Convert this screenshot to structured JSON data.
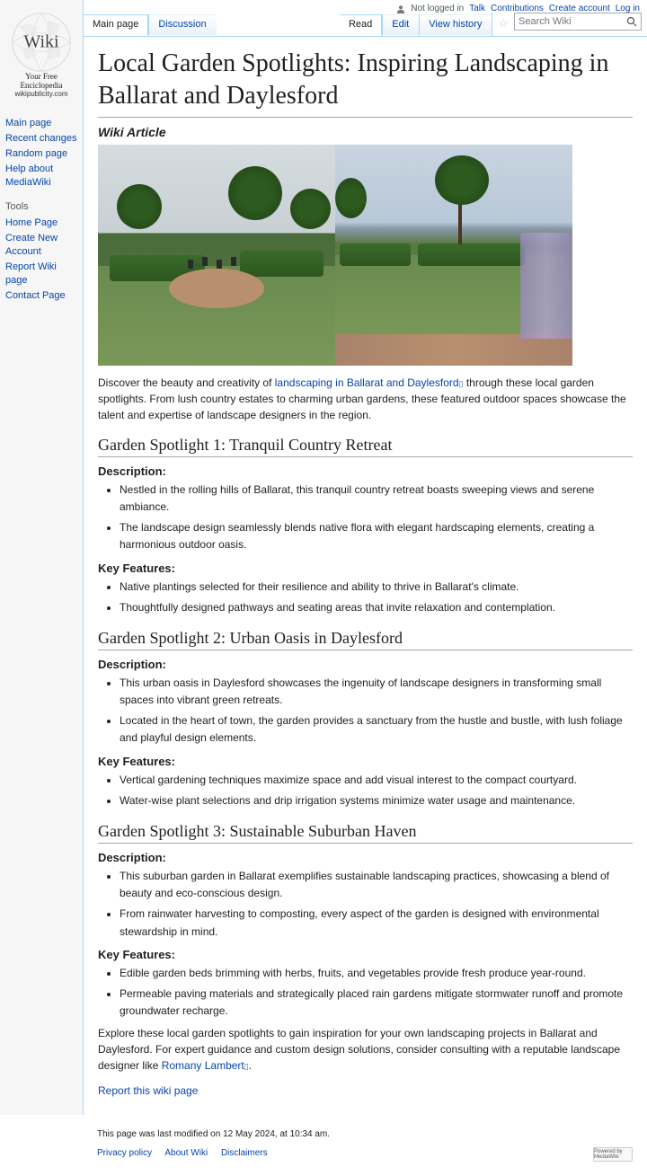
{
  "logo": {
    "name": "Wiki",
    "tagline": "Your Free Enciclopedia",
    "url": "wikipublicity.com"
  },
  "sidebar": {
    "nav": [
      {
        "label": "Main page"
      },
      {
        "label": "Recent changes"
      },
      {
        "label": "Random page"
      },
      {
        "label": "Help about MediaWiki"
      }
    ],
    "tools_heading": "Tools",
    "tools": [
      {
        "label": "Home Page"
      },
      {
        "label": "Create New Account"
      },
      {
        "label": "Report Wiki page"
      },
      {
        "label": "Contact Page"
      }
    ]
  },
  "personal": {
    "not_logged": "Not logged in",
    "talk": "Talk",
    "contributions": "Contributions",
    "create_account": "Create account",
    "log_in": "Log in"
  },
  "tabs_left": [
    {
      "label": "Main page",
      "selected": true
    },
    {
      "label": "Discussion",
      "selected": false
    }
  ],
  "tabs_right": [
    {
      "label": "Read",
      "selected": true
    },
    {
      "label": "Edit",
      "selected": false
    },
    {
      "label": "View history",
      "selected": false
    }
  ],
  "search": {
    "placeholder": "Search Wiki"
  },
  "page": {
    "title": "Local Garden Spotlights: Inspiring Landscaping in Ballarat and Daylesford",
    "wiki_article": "Wiki Article",
    "intro_pre": "Discover the beauty and creativity of ",
    "intro_link": "landscaping in Ballarat and Daylesford",
    "intro_post": " through these local garden spotlights. From lush country estates to charming urban gardens, these featured outdoor spaces showcase the talent and expertise of landscape designers in the region.",
    "sections": [
      {
        "heading": "Garden Spotlight 1: Tranquil Country Retreat",
        "desc_h": "Description:",
        "desc": [
          "Nestled in the rolling hills of Ballarat, this tranquil country retreat boasts sweeping views and serene ambiance.",
          "The landscape design seamlessly blends native flora with elegant hardscaping elements, creating a harmonious outdoor oasis."
        ],
        "feat_h": "Key Features:",
        "feat": [
          "Native plantings selected for their resilience and ability to thrive in Ballarat's climate.",
          "Thoughtfully designed pathways and seating areas that invite relaxation and contemplation."
        ]
      },
      {
        "heading": "Garden Spotlight 2: Urban Oasis in Daylesford",
        "desc_h": "Description:",
        "desc": [
          "This urban oasis in Daylesford showcases the ingenuity of landscape designers in transforming small spaces into vibrant green retreats.",
          "Located in the heart of town, the garden provides a sanctuary from the hustle and bustle, with lush foliage and playful design elements."
        ],
        "feat_h": "Key Features:",
        "feat": [
          "Vertical gardening techniques maximize space and add visual interest to the compact courtyard.",
          "Water-wise plant selections and drip irrigation systems minimize water usage and maintenance."
        ]
      },
      {
        "heading": "Garden Spotlight 3: Sustainable Suburban Haven",
        "desc_h": "Description:",
        "desc": [
          "This suburban garden in Ballarat exemplifies sustainable landscaping practices, showcasing a blend of beauty and eco-conscious design.",
          "From rainwater harvesting to composting, every aspect of the garden is designed with environmental stewardship in mind."
        ],
        "feat_h": "Key Features:",
        "feat": [
          "Edible garden beds brimming with herbs, fruits, and vegetables provide fresh produce year-round.",
          "Permeable paving materials and strategically placed rain gardens mitigate stormwater runoff and promote groundwater recharge."
        ]
      }
    ],
    "outro_pre": "Explore these local garden spotlights to gain inspiration for your own landscaping projects in Ballarat and Daylesford. For expert guidance and custom design solutions, consider consulting with a reputable landscape designer like ",
    "outro_link": "Romany Lambert",
    "outro_post": ".",
    "report": "Report this wiki page"
  },
  "footer": {
    "modified": "This page was last modified on 12 May 2024, at 10:34 am.",
    "links": [
      {
        "label": "Privacy policy"
      },
      {
        "label": "About Wiki"
      },
      {
        "label": "Disclaimers"
      }
    ],
    "badge": "Powered by MediaWiki"
  }
}
